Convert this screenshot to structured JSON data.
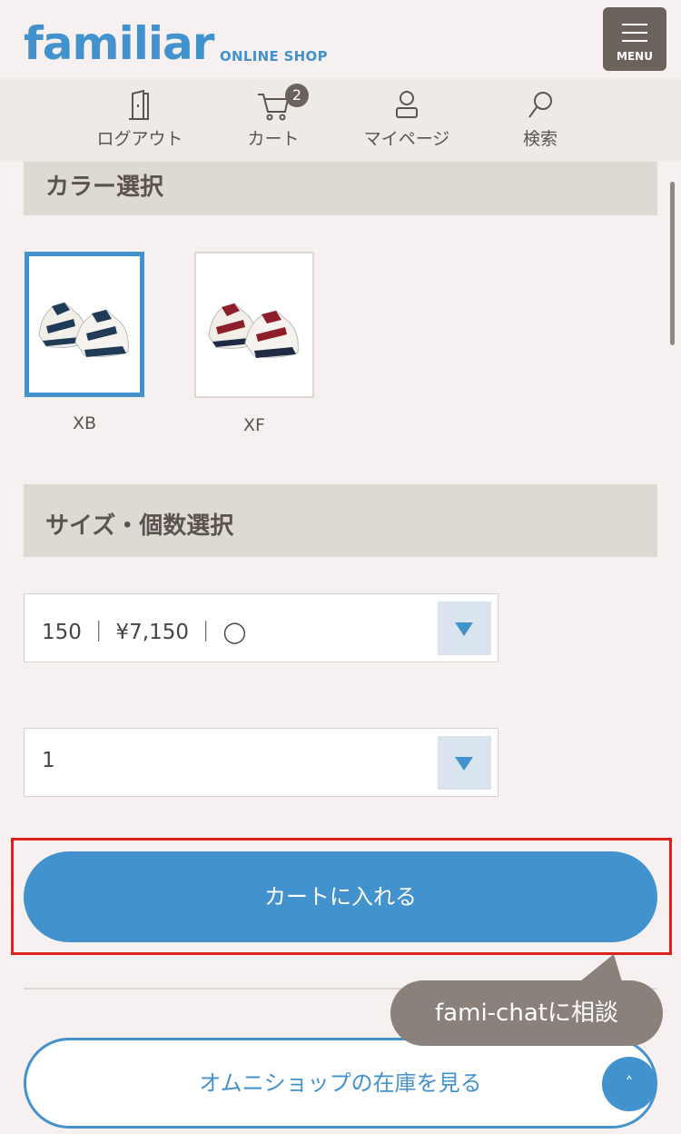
{
  "header": {
    "logo": "familiar",
    "logo_sub": "ONLINE SHOP",
    "menu_label": "MENU"
  },
  "nav": {
    "logout": "ログアウト",
    "cart": "カート",
    "cart_count": "2",
    "mypage": "マイページ",
    "search": "検索"
  },
  "color_section": {
    "title": "カラー選択",
    "options": [
      {
        "label": "XB",
        "color": "#1f3b57",
        "selected": true
      },
      {
        "label": "XF",
        "color": "#8c1f2a",
        "selected": false
      }
    ]
  },
  "size_section": {
    "title": "サイズ・個数選択",
    "size_select": "150 ｜ ¥7,150 ｜ ◯",
    "qty_select": "1"
  },
  "buttons": {
    "add_to_cart": "カートに入れる",
    "omni_stock": "オムニショップの在庫を見る",
    "chat": "fami-chatに相談",
    "to_top": "˄"
  },
  "colors": {
    "accent": "#4292cd",
    "highlight": "#d9231d"
  }
}
